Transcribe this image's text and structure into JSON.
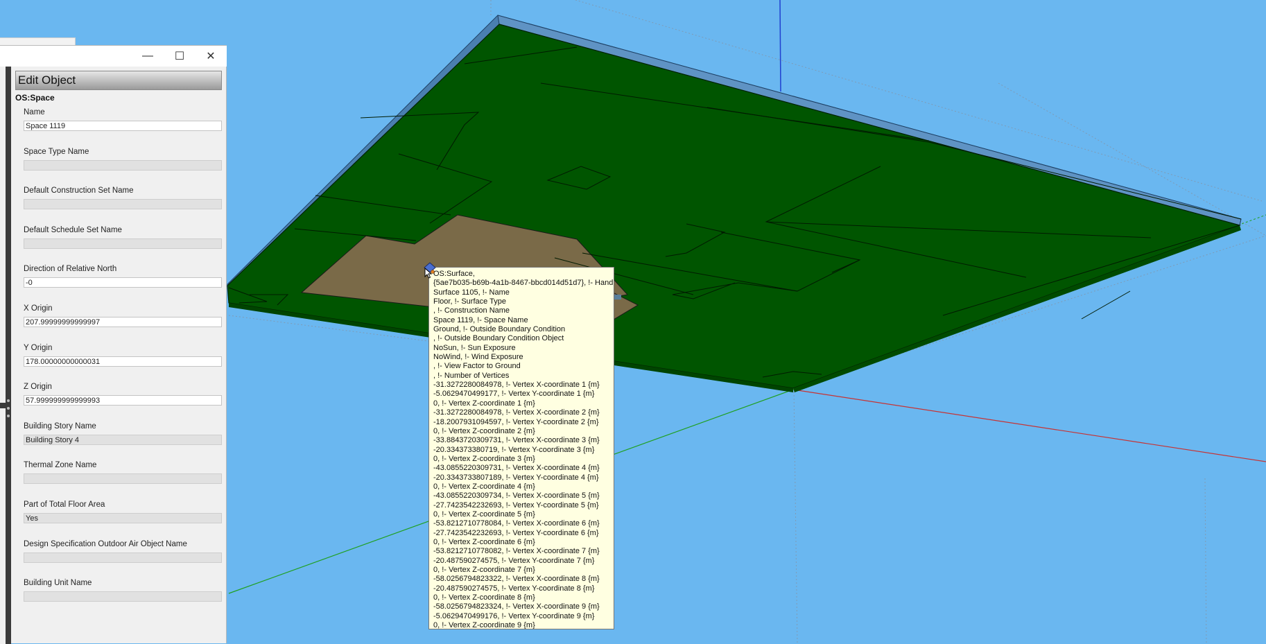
{
  "dialog": {
    "header": "Edit Object",
    "object_type": "OS:Space",
    "window_controls": {
      "minimize": "—",
      "maximize": "☐",
      "close": "✕"
    },
    "fields": [
      {
        "label": "Name",
        "value": "Space 1119",
        "editable": true
      },
      {
        "label": "Space Type Name",
        "value": "",
        "editable": false
      },
      {
        "label": "Default Construction Set Name",
        "value": "",
        "editable": false
      },
      {
        "label": "Default Schedule Set Name",
        "value": "",
        "editable": false
      },
      {
        "label": "Direction of Relative North",
        "value": "-0",
        "editable": true
      },
      {
        "label": "X Origin",
        "value": "207.99999999999997",
        "editable": true
      },
      {
        "label": "Y Origin",
        "value": "178.00000000000031",
        "editable": true
      },
      {
        "label": "Z Origin",
        "value": "57.999999999999993",
        "editable": true
      },
      {
        "label": "Building Story Name",
        "value": "Building Story 4",
        "editable": false
      },
      {
        "label": "Thermal Zone Name",
        "value": "",
        "editable": false
      },
      {
        "label": "Part of Total Floor Area",
        "value": "Yes",
        "editable": false
      },
      {
        "label": "Design Specification Outdoor Air Object Name",
        "value": "",
        "editable": false
      },
      {
        "label": "Building Unit Name",
        "value": "",
        "editable": false
      }
    ]
  },
  "tooltip": {
    "lines": [
      "OS:Surface,",
      "{5ae7b035-b69b-4a1b-8467-bbcd014d51d7}, !- Handle",
      "Surface 1105, !- Name",
      "Floor, !- Surface Type",
      ", !- Construction Name",
      "Space 1119, !- Space Name",
      "Ground, !- Outside Boundary Condition",
      ", !- Outside Boundary Condition Object",
      "NoSun, !- Sun Exposure",
      "NoWind, !- Wind Exposure",
      ", !- View Factor to Ground",
      ", !- Number of Vertices",
      "-31.3272280084978, !- Vertex X-coordinate 1 {m}",
      "-5.0629470499177, !- Vertex Y-coordinate 1 {m}",
      "0, !- Vertex Z-coordinate 1 {m}",
      "-31.3272280084978, !- Vertex X-coordinate 2 {m}",
      "-18.2007931094597, !- Vertex Y-coordinate 2 {m}",
      "0, !- Vertex Z-coordinate 2 {m}",
      "-33.8843720309731, !- Vertex X-coordinate 3 {m}",
      "-20.334373380719, !- Vertex Y-coordinate 3 {m}",
      "0, !- Vertex Z-coordinate 3 {m}",
      "-43.0855220309731, !- Vertex X-coordinate 4 {m}",
      "-20.3343733807189, !- Vertex Y-coordinate 4 {m}",
      "0, !- Vertex Z-coordinate 4 {m}",
      "-43.0855220309734, !- Vertex X-coordinate 5 {m}",
      "-27.7423542232693, !- Vertex Y-coordinate 5 {m}",
      "0, !- Vertex Z-coordinate 5 {m}",
      "-53.8212710778084, !- Vertex X-coordinate 6 {m}",
      "-27.7423542232693, !- Vertex Y-coordinate 6 {m}",
      "0, !- Vertex Z-coordinate 6 {m}",
      "-53.8212710778082, !- Vertex X-coordinate 7 {m}",
      "-20.487590274575, !- Vertex Y-coordinate 7 {m}",
      "0, !- Vertex Z-coordinate 7 {m}",
      "-58.0256794823322, !- Vertex X-coordinate 8 {m}",
      "-20.487590274575, !- Vertex Y-coordinate 8 {m}",
      "0, !- Vertex Z-coordinate 8 {m}",
      "-58.0256794823324, !- Vertex X-coordinate 9 {m}",
      "-5.0629470499176, !- Vertex Y-coordinate 9 {m}",
      "0, !- Vertex Z-coordinate 9 {m}"
    ]
  },
  "viewport": {
    "colors": {
      "sky": "#6ab7f0",
      "floor": "#005500",
      "selected_floor": "#7a6a48",
      "slab_edge": "#4a7fb0",
      "axis_x": "#c83232",
      "axis_y": "#1fa01f",
      "axis_z": "#1f3fd0"
    }
  }
}
